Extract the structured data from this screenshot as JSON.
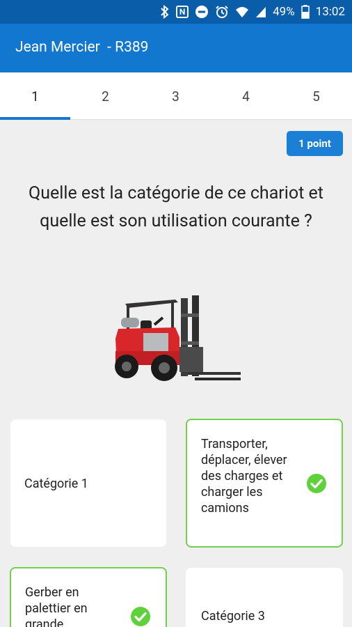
{
  "status_bar": {
    "battery_text": "49%",
    "time": "13:02",
    "nfc_label": "N",
    "icons": [
      "bluetooth-icon",
      "nfc-icon",
      "do-not-disturb-icon",
      "alarm-icon",
      "wifi-icon",
      "signal-icon",
      "battery-icon"
    ]
  },
  "app_bar": {
    "title": "Jean Mercier  - R389"
  },
  "tabs": [
    "1",
    "2",
    "3",
    "4",
    "5"
  ],
  "question": {
    "points_badge": "1 point",
    "text": "Quelle est la catégorie de ce chariot et quelle est son utilisation courante ?",
    "image": "forklift-image"
  },
  "answers": [
    {
      "text": "Catégorie 1",
      "selected": false
    },
    {
      "text": "Transporter, déplacer, élever des charges et charger les camions",
      "selected": true
    },
    {
      "text": "Gerber en palettier en grande",
      "selected": true
    },
    {
      "text": "Catégorie 3",
      "selected": false
    }
  ],
  "colors": {
    "status_bar": "#0a5da8",
    "app_bar": "#1177cf",
    "badge": "#1b7fd6",
    "correct_border": "#72d14a",
    "check": "#5fd13a"
  }
}
